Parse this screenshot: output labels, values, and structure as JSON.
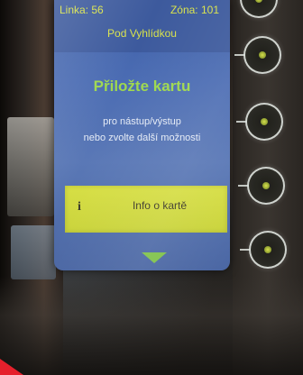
{
  "header": {
    "line": "Linka: 56",
    "zone": "Zóna: 101",
    "stop": "Pod Vyhlídkou"
  },
  "main": {
    "headline": "Přiložte kartu",
    "subtext_line1": "pro nástup/výstup",
    "subtext_line2": "nebo zvolte další možnosti"
  },
  "info_button": {
    "icon": "i",
    "label": "Info o kartě"
  },
  "colors": {
    "screen_bg": "#4b6cb3",
    "header_text": "#d8e24a",
    "headline": "#9ed84e",
    "button_bg": "#d7df45",
    "arrow": "#7fc24a"
  },
  "icons": {
    "scroll": "arrow-down-icon",
    "side_buttons": "round-hardware-button"
  }
}
